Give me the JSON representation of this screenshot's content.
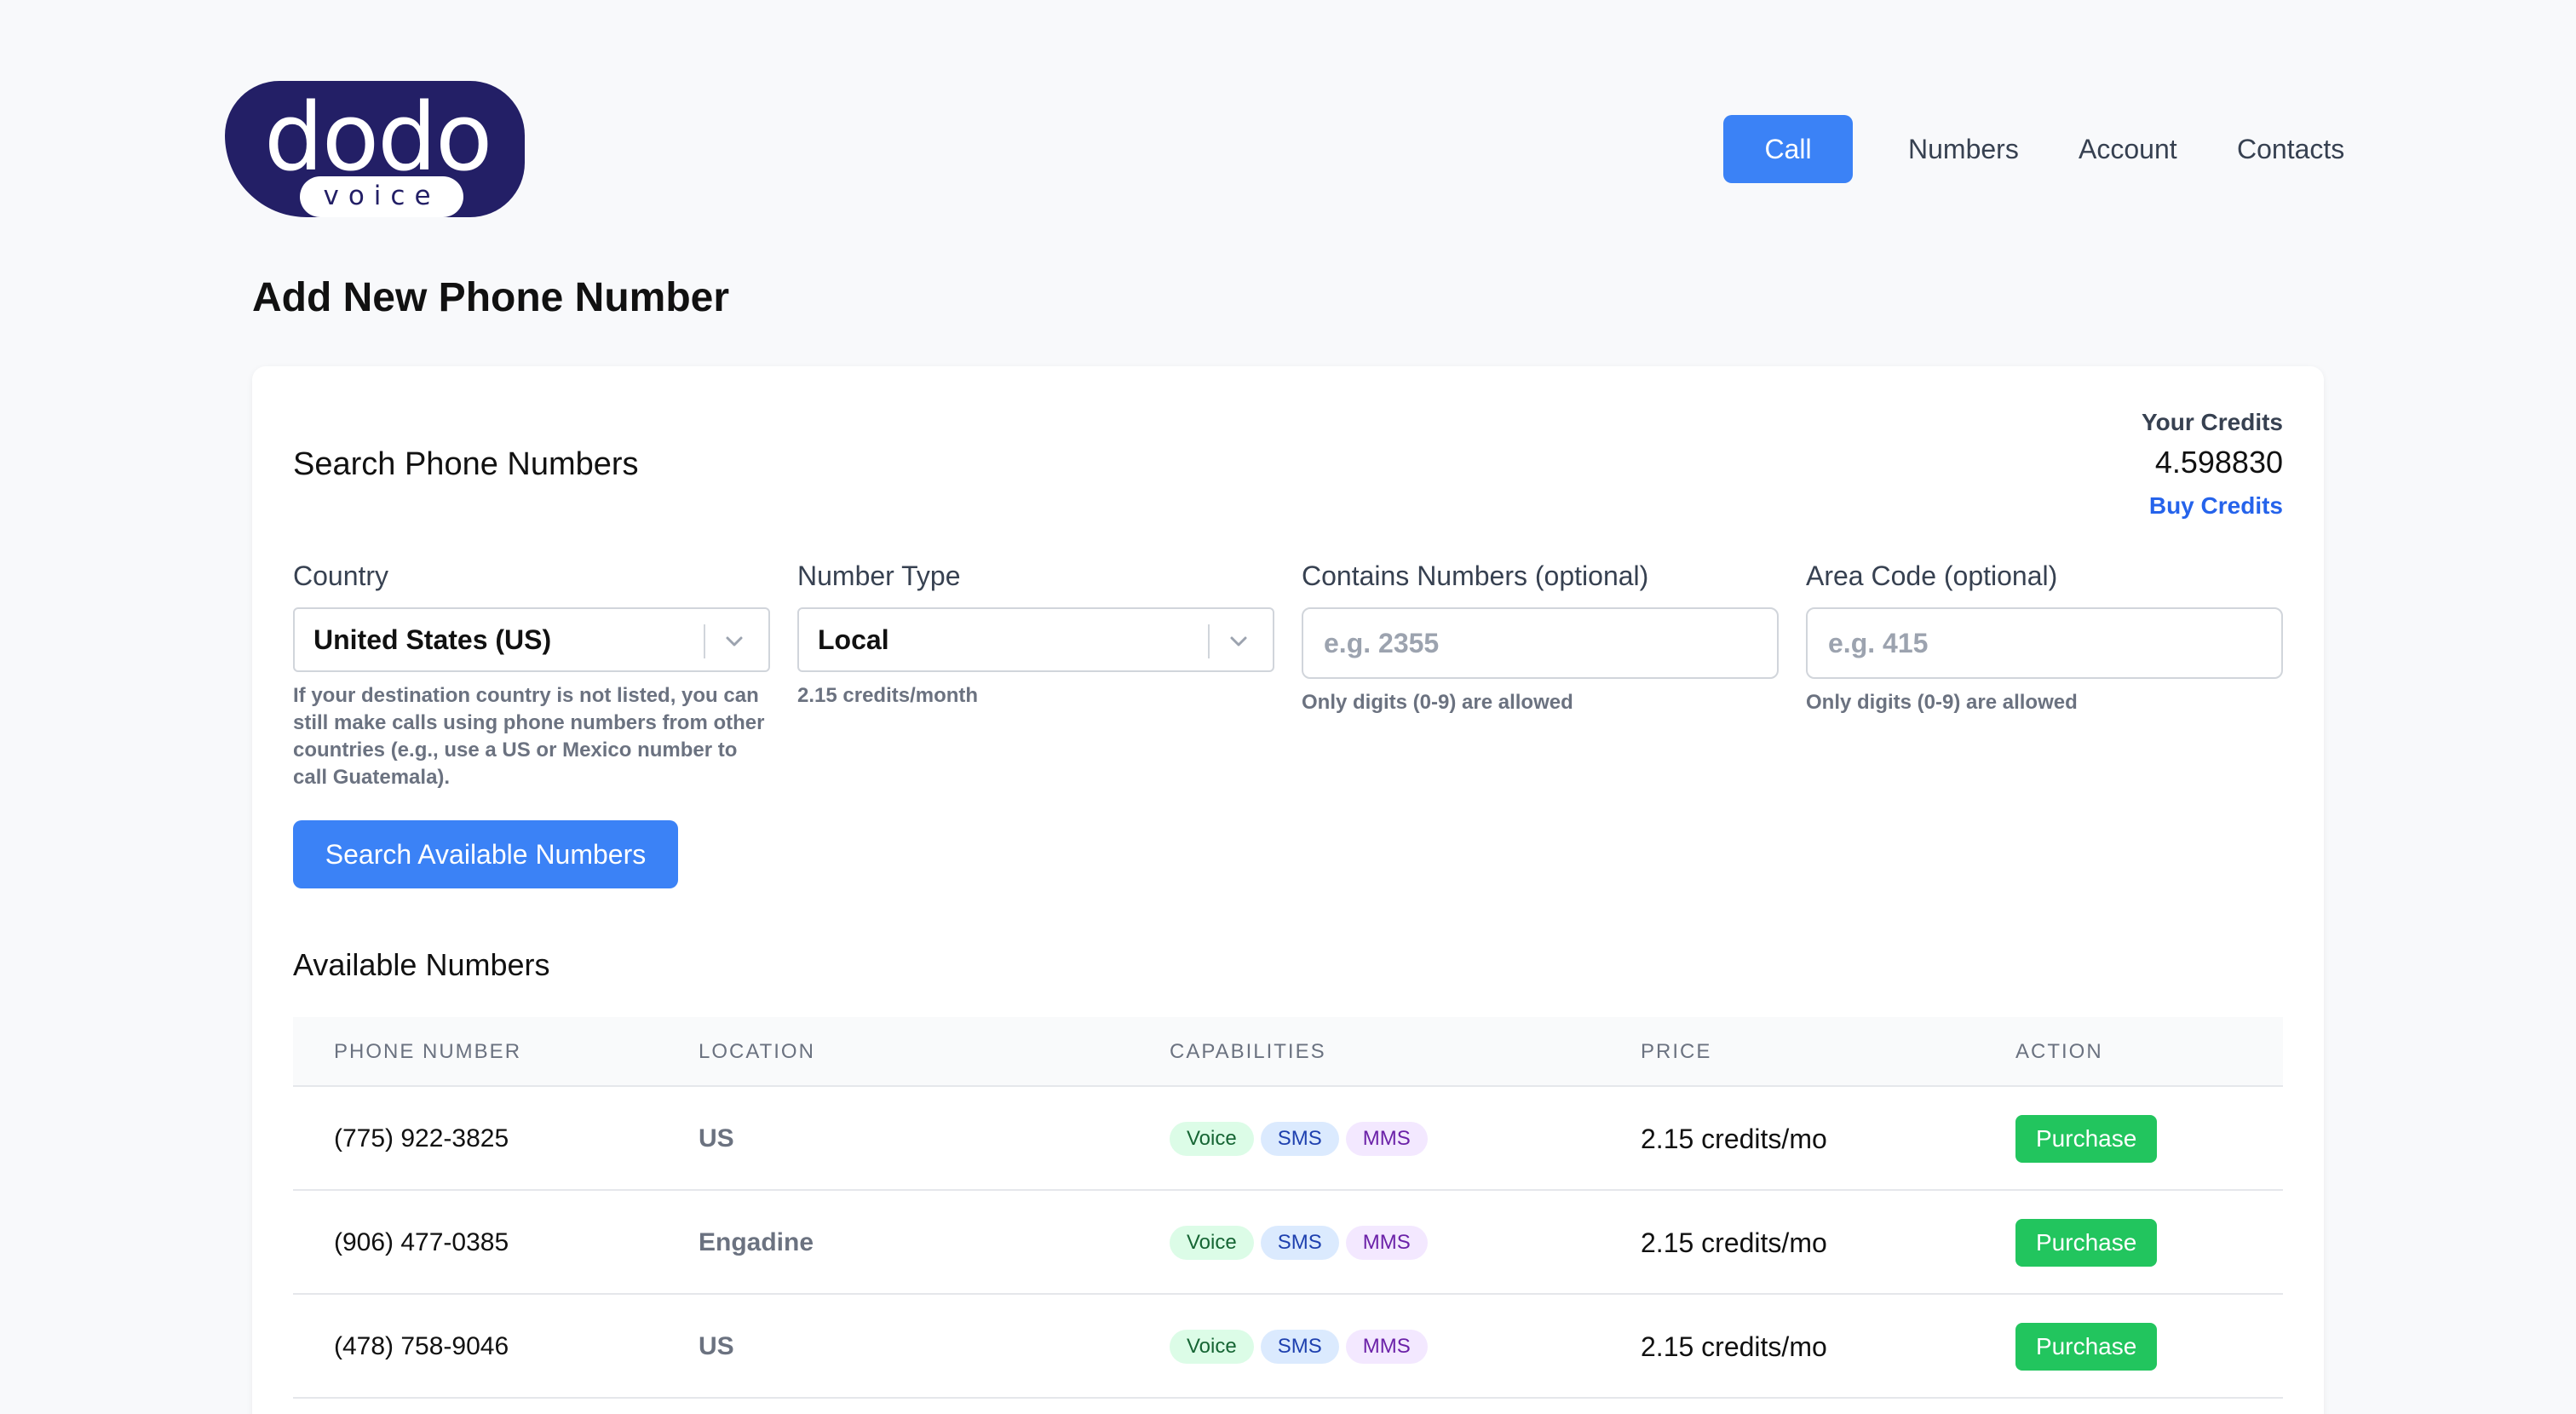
{
  "logo": {
    "main": "dodo",
    "sub": "voice"
  },
  "nav": {
    "call": "Call",
    "numbers": "Numbers",
    "account": "Account",
    "contacts": "Contacts"
  },
  "page_title": "Add New Phone Number",
  "search": {
    "title": "Search Phone Numbers",
    "credits": {
      "label": "Your Credits",
      "value": "4.598830",
      "buy": "Buy Credits"
    },
    "country": {
      "label": "Country",
      "value": "United States (US)",
      "hint": "If your destination country is not listed, you can still make calls using phone numbers from other countries (e.g., use a US or Mexico number to call Guatemala)."
    },
    "number_type": {
      "label": "Number Type",
      "value": "Local",
      "hint": "2.15 credits/month"
    },
    "contains": {
      "label": "Contains Numbers (optional)",
      "placeholder": "e.g. 2355",
      "hint": "Only digits (0-9) are allowed"
    },
    "area_code": {
      "label": "Area Code (optional)",
      "placeholder": "e.g. 415",
      "hint": "Only digits (0-9) are allowed"
    },
    "button": "Search Available Numbers"
  },
  "available": {
    "title": "Available Numbers",
    "columns": {
      "phone": "PHONE NUMBER",
      "location": "LOCATION",
      "capabilities": "CAPABILITIES",
      "price": "PRICE",
      "action": "ACTION"
    },
    "rows": [
      {
        "phone": "(775) 922-3825",
        "location": "US",
        "voice": "Voice",
        "sms": "SMS",
        "mms": "MMS",
        "price": "2.15 credits/mo",
        "action": "Purchase"
      },
      {
        "phone": "(906) 477-0385",
        "location": "Engadine",
        "voice": "Voice",
        "sms": "SMS",
        "mms": "MMS",
        "price": "2.15 credits/mo",
        "action": "Purchase"
      },
      {
        "phone": "(478) 758-9046",
        "location": "US",
        "voice": "Voice",
        "sms": "SMS",
        "mms": "MMS",
        "price": "2.15 credits/mo",
        "action": "Purchase"
      }
    ]
  },
  "colors": {
    "primary": "#3b82f6",
    "brand": "#231f66",
    "success": "#22c55e"
  }
}
